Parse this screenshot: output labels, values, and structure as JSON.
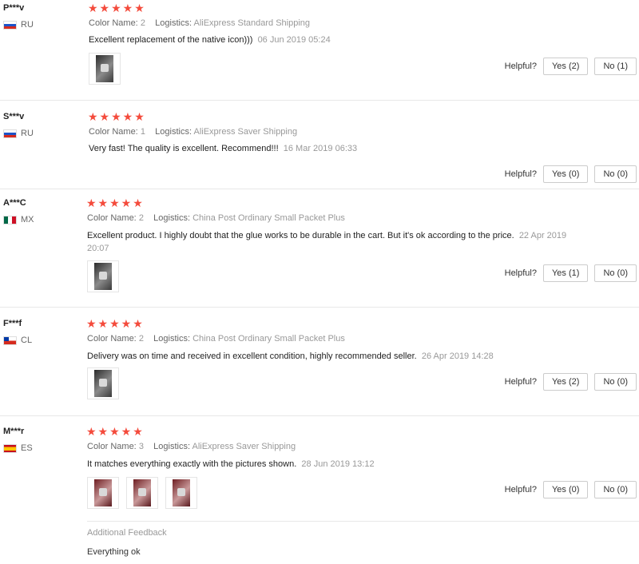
{
  "labels": {
    "color_name": "Color Name:",
    "logistics": "Logistics:",
    "helpful": "Helpful?"
  },
  "stars": "★★★★★",
  "colors": {
    "star": "#f44b3c",
    "muted": "#999999",
    "separator": "#e8e8e8"
  },
  "reviews": [
    {
      "user": "P***v",
      "country": "RU",
      "flag_icon": "flag-russia-icon",
      "rating": 5,
      "color_name": "2",
      "logistics": "AliExpress Standard Shipping",
      "feedback": "Excellent replacement of the native icon)))",
      "date": "06 Jun 2019 05:24",
      "photos": 1,
      "yes": "Yes (2)",
      "no": "No (1)"
    },
    {
      "user": "S***v",
      "country": "RU",
      "flag_icon": "flag-russia-icon",
      "rating": 5,
      "color_name": "1",
      "logistics": "AliExpress Saver Shipping",
      "feedback": "Very fast! The quality is excellent. Recommend!!!",
      "date": "16 Mar 2019 06:33",
      "photos": 0,
      "yes": "Yes (0)",
      "no": "No (0)"
    },
    {
      "user": "A***C",
      "country": "MX",
      "flag_icon": "flag-mexico-icon",
      "rating": 5,
      "color_name": "2",
      "logistics": "China Post Ordinary Small Packet Plus",
      "feedback": "Excellent product. I highly doubt that the glue works to be durable in the cart. But it's ok according to the price.",
      "date": "22 Apr 2019 20:07",
      "photos": 1,
      "yes": "Yes (1)",
      "no": "No (0)"
    },
    {
      "user": "F***f",
      "country": "CL",
      "flag_icon": "flag-chile-icon",
      "rating": 5,
      "color_name": "2",
      "logistics": "China Post Ordinary Small Packet Plus",
      "feedback": "Delivery was on time and received in excellent condition, highly recommended seller.",
      "date": "26 Apr 2019 14:28",
      "photos": 1,
      "yes": "Yes (2)",
      "no": "No (0)"
    },
    {
      "user": "M***r",
      "country": "ES",
      "flag_icon": "flag-spain-icon",
      "rating": 5,
      "color_name": "3",
      "logistics": "AliExpress Saver Shipping",
      "feedback": "It matches everything exactly with the pictures shown.",
      "date": "28 Jun 2019 13:12",
      "photos": 3,
      "yes": "Yes (0)",
      "no": "No (0)",
      "additional_feedback_title": "Additional Feedback",
      "additional_feedback": "Everything ok"
    }
  ]
}
